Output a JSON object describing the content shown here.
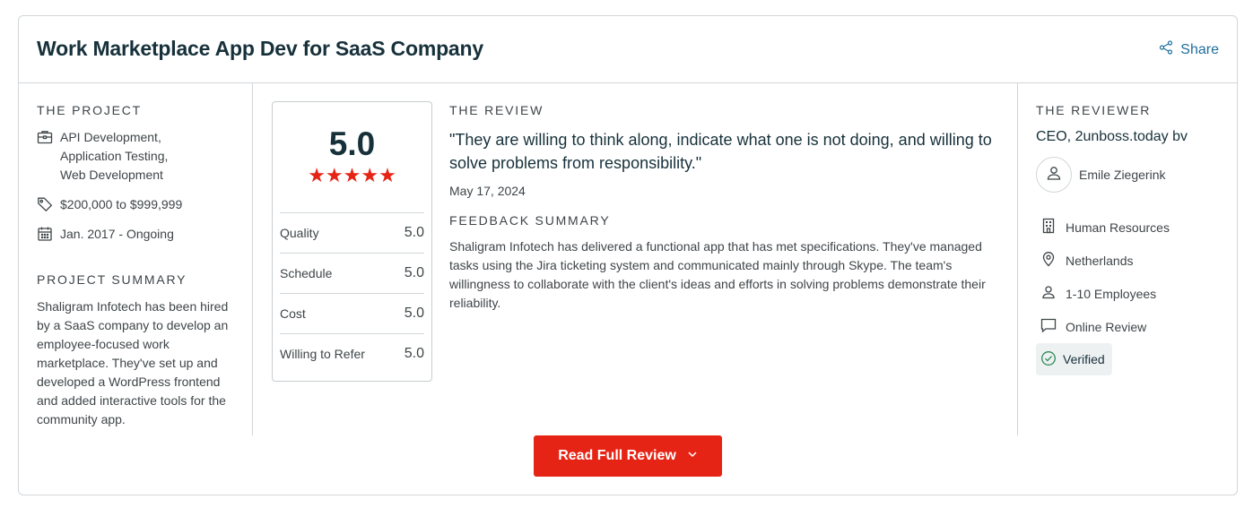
{
  "header": {
    "title": "Work Marketplace App Dev for SaaS Company",
    "share_label": "Share"
  },
  "project": {
    "section_label": "THE PROJECT",
    "services": [
      "API Development,",
      "Application Testing,",
      "Web Development"
    ],
    "budget": "$200,000 to $999,999",
    "dates": "Jan. 2017 - Ongoing",
    "summary_label": "PROJECT SUMMARY",
    "summary": "Shaligram Infotech has been hired by a SaaS company to develop an employee-focused work marketplace. They've set up and developed a WordPress frontend and added interactive tools for the community app."
  },
  "rating": {
    "overall": "5.0",
    "stars": 5,
    "star_glyphs": "★★★★★",
    "rows": [
      {
        "label": "Quality",
        "value": "5.0"
      },
      {
        "label": "Schedule",
        "value": "5.0"
      },
      {
        "label": "Cost",
        "value": "5.0"
      },
      {
        "label": "Willing to Refer",
        "value": "5.0"
      }
    ]
  },
  "review": {
    "section_label": "THE REVIEW",
    "quote": "\"They are willing to think along, indicate what one is not doing, and willing to solve problems from responsibility.\"",
    "date": "May 17, 2024",
    "feedback_label": "FEEDBACK SUMMARY",
    "feedback": "Shaligram Infotech has delivered a functional app that has met specifications. They've managed tasks using the Jira ticketing system and communicated mainly through Skype. The team's willingness to collaborate with the client's ideas and efforts in solving problems demonstrate their reliability."
  },
  "reviewer": {
    "section_label": "THE REVIEWER",
    "title": "CEO, 2unboss.today bv",
    "name": "Emile Ziegerink",
    "industry": "Human Resources",
    "location": "Netherlands",
    "company_size": "1-10 Employees",
    "review_method": "Online Review",
    "verified_label": "Verified"
  },
  "cta": {
    "read_full_label": "Read Full Review"
  },
  "colors": {
    "accent_red": "#e62415",
    "link_blue": "#1f6f9c",
    "heading": "#17313b",
    "verified_green": "#2e8b57"
  },
  "icons": {
    "share": "share-icon",
    "services": "briefcase-icon",
    "budget": "tag-icon",
    "dates": "calendar-icon",
    "avatar": "user-icon",
    "industry": "building-icon",
    "location": "map-pin-icon",
    "size": "person-icon",
    "method": "chat-bubble-icon",
    "verified": "check-circle-icon",
    "cta": "chevron-down-icon"
  }
}
